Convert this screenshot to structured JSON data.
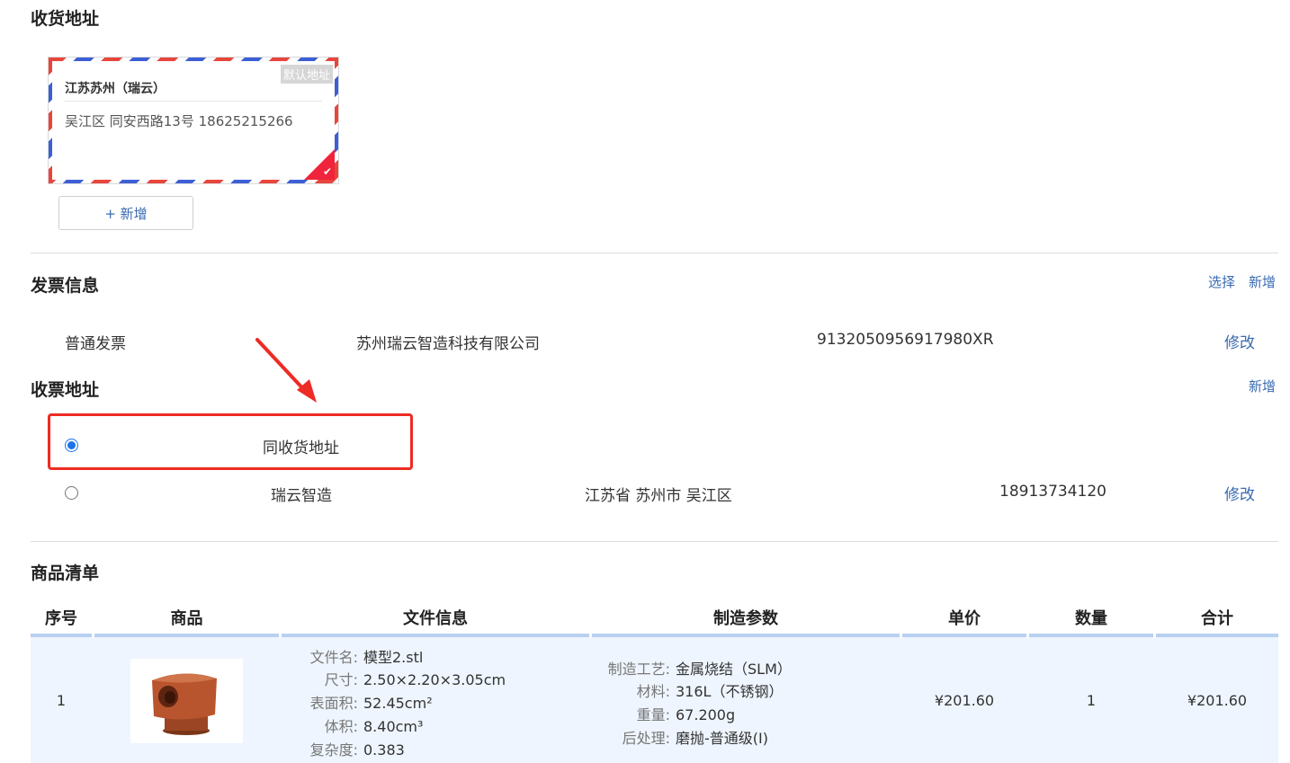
{
  "shipping": {
    "title": "收货地址",
    "card": {
      "name": "江苏苏州（瑞云）",
      "detail": "吴江区 同安西路13号 18625215266",
      "default_tag": "默认地址"
    },
    "add_label": "+ 新增"
  },
  "invoice": {
    "title": "发票信息",
    "select_label": "选择",
    "add_label": "新增",
    "type": "普通发票",
    "company": "苏州瑞云智造科技有限公司",
    "tax_id": "9132050956917980XR",
    "edit_label": "修改"
  },
  "invoice_address": {
    "title": "收票地址",
    "add_label": "新增",
    "options": [
      {
        "label": "同收货地址",
        "checked": true
      },
      {
        "label": "瑞云智造",
        "region": "江苏省 苏州市 吴江区",
        "phone": "18913734120",
        "edit_label": "修改",
        "checked": false
      }
    ]
  },
  "products": {
    "title": "商品清单",
    "headers": [
      "序号",
      "商品",
      "文件信息",
      "制造参数",
      "单价",
      "数量",
      "合计"
    ],
    "rows": [
      {
        "index": "1",
        "file_info": [
          {
            "k": "文件名:",
            "v": "模型2.stl"
          },
          {
            "k": "尺寸:",
            "v": "2.50×2.20×3.05cm"
          },
          {
            "k": "表面积:",
            "v": "52.45cm²"
          },
          {
            "k": "体积:",
            "v": "8.40cm³"
          },
          {
            "k": "复杂度:",
            "v": "0.383"
          }
        ],
        "params": [
          {
            "k": "制造工艺:",
            "v": "金属烧结（SLM）"
          },
          {
            "k": "材料:",
            "v": "316L（不锈钢）"
          },
          {
            "k": "重量:",
            "v": "67.200g"
          },
          {
            "k": "后处理:",
            "v": "磨抛-普通级(I)"
          }
        ],
        "unit_price": "¥201.60",
        "qty": "1",
        "total": "¥201.60"
      }
    ]
  },
  "colors": {
    "accent": "#3a6bb0",
    "highlight": "#ee2b24",
    "model": "#b8552e"
  }
}
